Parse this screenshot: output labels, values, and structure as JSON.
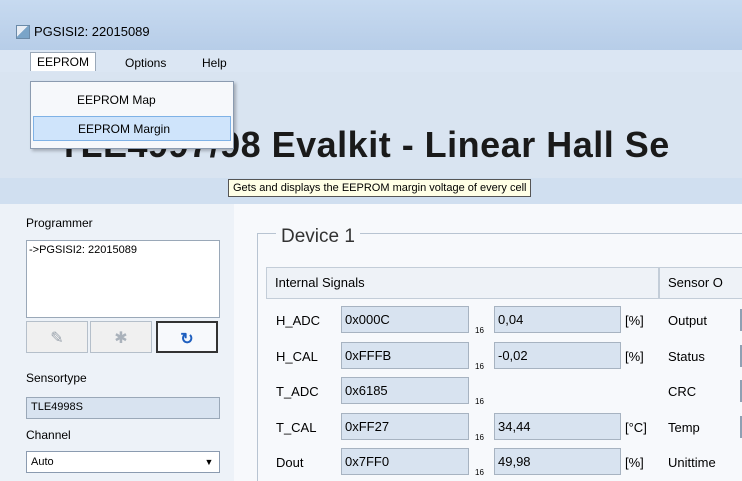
{
  "window": {
    "title": "PGSISI2: 22015089"
  },
  "menu": {
    "eeprom": "EEPROM",
    "options": "Options",
    "help": "Help"
  },
  "dropdown": {
    "items": [
      "EEPROM Map",
      "EEPROM Margin"
    ]
  },
  "banner": {
    "title": "TLE4997/98 Evalkit - Linear Hall Se"
  },
  "tooltip": "Gets and displays the EEPROM margin voltage of every cell",
  "left": {
    "programmer_label": "Programmer",
    "programmer_item": "->PGSISI2: 22015089",
    "sensortype_label": "Sensortype",
    "sensortype_value": "TLE4998S",
    "channel_label": "Channel",
    "channel_value": "Auto"
  },
  "device": {
    "title": "Device 1",
    "internal_header": "Internal Signals",
    "sensor_header": "Sensor O",
    "rows": [
      {
        "label": "H_ADC",
        "hex": "0x000C",
        "base": "16",
        "value": "0,04",
        "unit": "[%]",
        "right": "Output"
      },
      {
        "label": "H_CAL",
        "hex": "0xFFFB",
        "base": "16",
        "value": "-0,02",
        "unit": "[%]",
        "right": "Status"
      },
      {
        "label": "T_ADC",
        "hex": "0x6185",
        "base": "16",
        "value": "",
        "unit": "",
        "right": "CRC"
      },
      {
        "label": "T_CAL",
        "hex": "0xFF27",
        "base": "16",
        "value": "34,44",
        "unit": "[°C]",
        "right": "Temp"
      },
      {
        "label": "Dout",
        "hex": "0x7FF0",
        "base": "16",
        "value": "49,98",
        "unit": "[%]",
        "right": "Unittime"
      }
    ]
  },
  "icons": {
    "app": "app-icon",
    "pencil": "pencil-icon",
    "pin": "pin-icon",
    "refresh": "refresh-icon",
    "dropdown_arrow": "chevron-down-icon"
  }
}
